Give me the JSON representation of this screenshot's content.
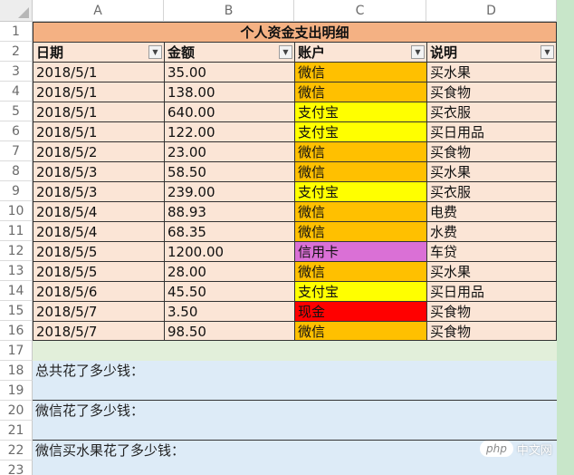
{
  "columns": [
    "A",
    "B",
    "C",
    "D"
  ],
  "rows": [
    "1",
    "2",
    "3",
    "4",
    "5",
    "6",
    "7",
    "8",
    "9",
    "10",
    "11",
    "12",
    "13",
    "14",
    "15",
    "16",
    "17",
    "18",
    "19",
    "20",
    "21",
    "22",
    "23"
  ],
  "title": "个人资金支出明细",
  "headers": [
    "日期",
    "金额",
    "账户",
    "说明"
  ],
  "filter_icon": "▼",
  "records": [
    {
      "date": "2018/5/1",
      "amount": "35.00",
      "account": "微信",
      "note": "买水果",
      "account_color": "#ffc000"
    },
    {
      "date": "2018/5/1",
      "amount": "138.00",
      "account": "微信",
      "note": "买食物",
      "account_color": "#ffc000"
    },
    {
      "date": "2018/5/1",
      "amount": "640.00",
      "account": "支付宝",
      "note": "买衣服",
      "account_color": "#ffff00"
    },
    {
      "date": "2018/5/1",
      "amount": "122.00",
      "account": "支付宝",
      "note": "买日用品",
      "account_color": "#ffff00"
    },
    {
      "date": "2018/5/2",
      "amount": "23.00",
      "account": "微信",
      "note": "买食物",
      "account_color": "#ffc000"
    },
    {
      "date": "2018/5/3",
      "amount": "58.50",
      "account": "微信",
      "note": "买水果",
      "account_color": "#ffc000"
    },
    {
      "date": "2018/5/3",
      "amount": "239.00",
      "account": "支付宝",
      "note": "买衣服",
      "account_color": "#ffff00"
    },
    {
      "date": "2018/5/4",
      "amount": "88.93",
      "account": "微信",
      "note": "电费",
      "account_color": "#ffc000"
    },
    {
      "date": "2018/5/4",
      "amount": "68.35",
      "account": "微信",
      "note": "水费",
      "account_color": "#ffc000"
    },
    {
      "date": "2018/5/5",
      "amount": "1200.00",
      "account": "信用卡",
      "note": "车贷",
      "account_color": "#da70d6"
    },
    {
      "date": "2018/5/5",
      "amount": "28.00",
      "account": "微信",
      "note": "买水果",
      "account_color": "#ffc000"
    },
    {
      "date": "2018/5/6",
      "amount": "45.50",
      "account": "支付宝",
      "note": "买日用品",
      "account_color": "#ffff00"
    },
    {
      "date": "2018/5/7",
      "amount": "3.50",
      "account": "现金",
      "note": "买食物",
      "account_color": "#ff0000"
    },
    {
      "date": "2018/5/7",
      "amount": "98.50",
      "account": "微信",
      "note": "买食物",
      "account_color": "#ffc000"
    }
  ],
  "questions": [
    "总共花了多少钱：",
    "微信花了多少钱：",
    "微信买水果花了多少钱："
  ],
  "watermark": {
    "logo": "php",
    "site": "中文网"
  }
}
